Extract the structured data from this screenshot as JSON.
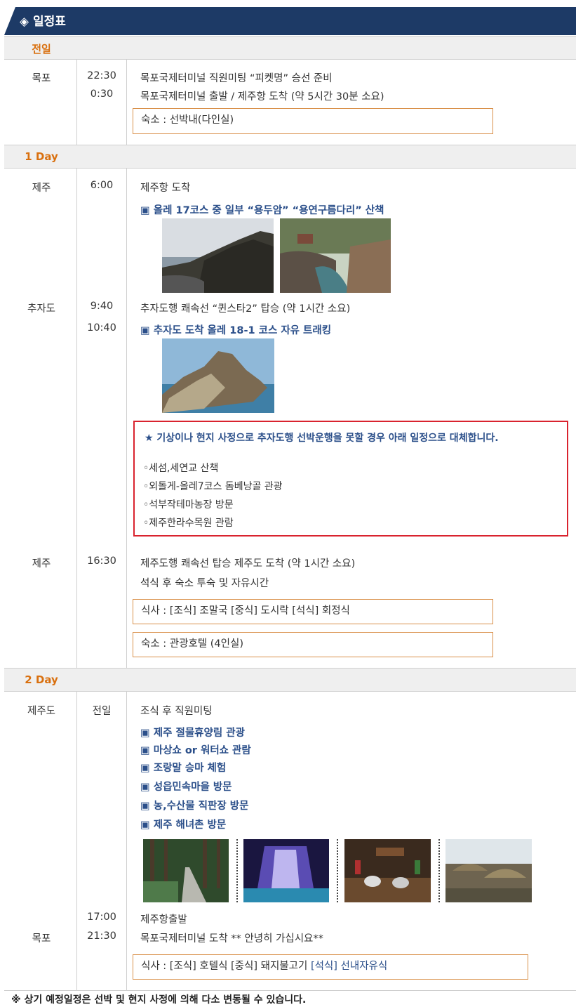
{
  "header": {
    "title": "◈ 일정표"
  },
  "days": {
    "d0": "전일",
    "d1": "1 Day",
    "d2": "2 Day"
  },
  "prev_day": {
    "place": "목포",
    "times": [
      "22:30",
      "0:30"
    ],
    "lines": [
      "목포국제터미널 직원미팅 “피켓명” 승선 준비",
      "목포국제터미널 출발 / 제주항 도착 (약 5시간 30분 소요)"
    ],
    "lodging": "숙소 : 선박내(다인실)"
  },
  "day1": {
    "place1": "제주",
    "time1": "6:00",
    "line1": "제주항 도착",
    "highlight1": "▣ 올레 17코스 중 일부 “용두암” “용연구름다리” 산책",
    "place2": "추자도",
    "time2a": "9:40",
    "time2b": "10:40",
    "line2": "추자도행 쾌속선 “퀸스타2” 탑승 (약 1시간 소요)",
    "highlight2": "▣ 추자도 도착 올레 18-1 코스 자유 트래킹",
    "notice": {
      "title": "★ 기상이나 현지 사정으로 추자도행 선박운행을 못할 경우 아래 일정으로 대체합니다.",
      "items": [
        "◦세섬,세연교 산책",
        "◦외돌게-올레7코스 돔베낭골 관광",
        "◦석부작테마농장 방문",
        "◦제주한라수목원 관람"
      ]
    },
    "place3": "제주",
    "time3": "16:30",
    "line3a": "제주도행 쾌속선 탑승 제주도 도착 (약 1시간 소요)",
    "line3b": "석식 후 숙소 투숙 및 자유시간",
    "meals": "식사 : [조식] 조말국      [중식] 도시락     [석식] 회정식",
    "lodging": "숙소 : 관광호텔 (4인실)"
  },
  "day2": {
    "place1": "제주도",
    "time1": "전일",
    "line1": "조식 후 직원미팅",
    "highlights": [
      "▣ 제주 절물휴양림 관광",
      "▣ 마상쇼 or 워터쇼 관람",
      "▣ 조랑말 승마 체험",
      "▣ 성읍민속마을 방문",
      "▣ 농,수산물 직판장 방문",
      "▣ 제주 해녀촌 방문"
    ],
    "time2": "17:00",
    "line2": "제주항출발",
    "place3": "목포",
    "time3": "21:30",
    "line3": "목포국제터미널 도착    ** 안녕히 가십시요**",
    "meals_a": "식사 : [조식] 호텔식   [중식]  돼지불고기   ",
    "meals_b": "[석식] 선내자유식"
  },
  "footer": "※ 상기 예정일정은 선박 및 현지 사정에 의해 다소 변동될 수 있습니다.",
  "colors": {
    "header_bg": "#1d3a66",
    "day_label": "#d9700f",
    "highlight": "#2b4f8a",
    "notice_border": "#d9232e",
    "box_border": "#d9904a"
  }
}
